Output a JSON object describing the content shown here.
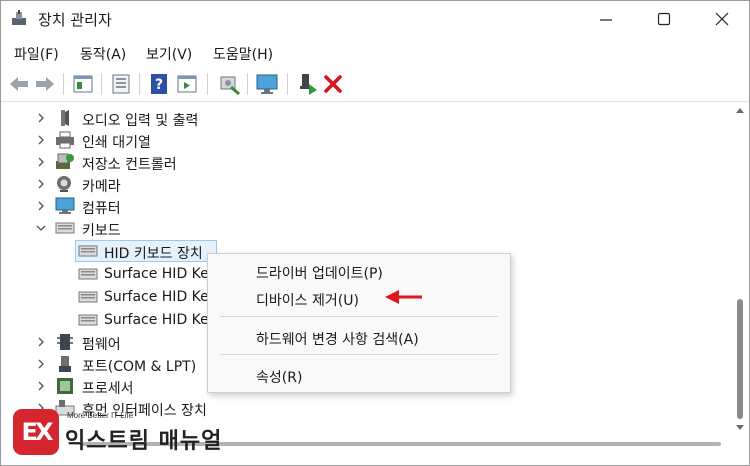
{
  "window": {
    "title": "장치 관리자"
  },
  "menu": {
    "items": [
      "파일(F)",
      "동작(A)",
      "보기(V)",
      "도움말(H)"
    ]
  },
  "toolbar": {
    "buttons": [
      "back-icon",
      "forward-icon",
      "properties-pane-icon",
      "update-driver-icon",
      "help-icon",
      "show-hidden-icon",
      "scan-hardware-icon",
      "monitor-icon",
      "enable-device-icon",
      "uninstall-device-icon"
    ]
  },
  "tree": {
    "categories_top": [
      {
        "label": "오디오 입력 및 출력",
        "icon": "audio-icon"
      },
      {
        "label": "인쇄 대기열",
        "icon": "printer-icon"
      },
      {
        "label": "저장소 컨트롤러",
        "icon": "storage-controller-icon"
      },
      {
        "label": "카메라",
        "icon": "camera-icon"
      },
      {
        "label": "컴퓨터",
        "icon": "computer-icon"
      }
    ],
    "keyboard": {
      "label": "키보드",
      "children": [
        "HID 키보드 장치",
        "Surface HID Key",
        "Surface HID Key",
        "Surface HID Key"
      ]
    },
    "categories_bottom": [
      {
        "label": "펌웨어",
        "icon": "firmware-icon"
      },
      {
        "label": "포트(COM & LPT)",
        "icon": "port-icon"
      },
      {
        "label": "프로세서",
        "icon": "processor-icon"
      },
      {
        "label": "휴먼 인터페이스 장치",
        "icon": "hid-icon"
      }
    ]
  },
  "context_menu": {
    "items": [
      "드라이버 업데이트(P)",
      "디바이스 제거(U)",
      "하드웨어 변경 사항 검색(A)",
      "속성(R)"
    ]
  },
  "colors": {
    "accent_red": "#e0141c",
    "selection": "#e5f1fb",
    "logo_red": "#d6262d"
  },
  "watermark": {
    "mark": "EX",
    "tagline": "More Better IT Life",
    "name": "익스트림 매뉴얼"
  }
}
